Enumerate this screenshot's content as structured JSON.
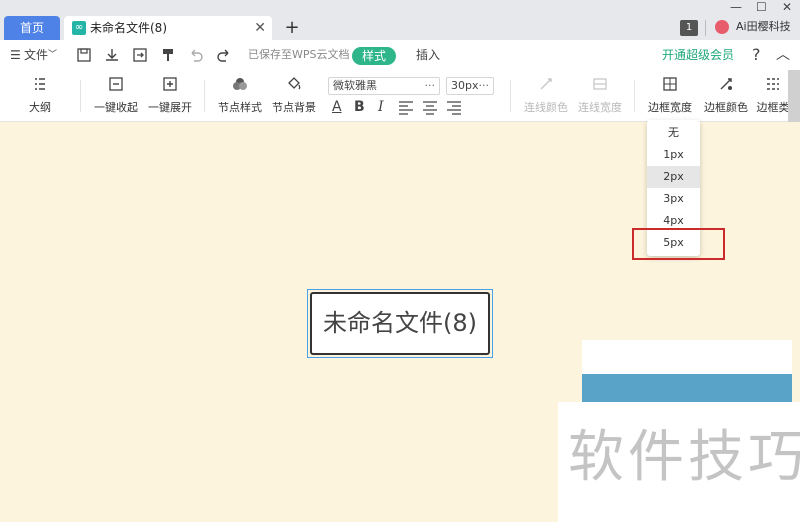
{
  "tabs": {
    "home_label": "首页",
    "doc_title": "未命名文件(8)",
    "close_glyph": "✕",
    "add_glyph": "+"
  },
  "window": {
    "minimize_glyph": "—",
    "maximize_glyph": "☐",
    "close_glyph": "✕",
    "badge": "1",
    "user_name": "Ai田樱科技"
  },
  "menubar": {
    "file_label": "文件",
    "saved_status": "已保存至WPS云文档",
    "style_tab": "样式",
    "insert_tab": "插入",
    "vip_link": "开通超级会员",
    "help_glyph": "?",
    "collapse_glyph": "︿"
  },
  "ribbon": {
    "outline": "大纲",
    "collapse_all": "一键收起",
    "expand_all": "一键展开",
    "node_style": "节点样式",
    "node_bg": "节点背景",
    "font_name": "微软雅黑",
    "font_size": "30px",
    "select_dots": "···",
    "fmt_color": "A",
    "fmt_bold": "B",
    "fmt_italic": "I",
    "line_color": "连线颜色",
    "line_width": "连线宽度",
    "border_width": "边框宽度",
    "border_color": "边框颜色",
    "border_type": "边框类"
  },
  "dropdown": {
    "items": [
      "无",
      "1px",
      "2px",
      "3px",
      "4px",
      "5px"
    ],
    "selected": "2px",
    "highlighted": "5px"
  },
  "canvas": {
    "node_text": "未命名文件(8)"
  },
  "watermark": "软件技巧",
  "colors": {
    "accent_blue": "#4f82e6",
    "style_pill": "#2fb58a",
    "vip_green": "#1fa87a",
    "canvas_bg": "#fcf4dc",
    "highlight_red": "#cc2b2b"
  }
}
